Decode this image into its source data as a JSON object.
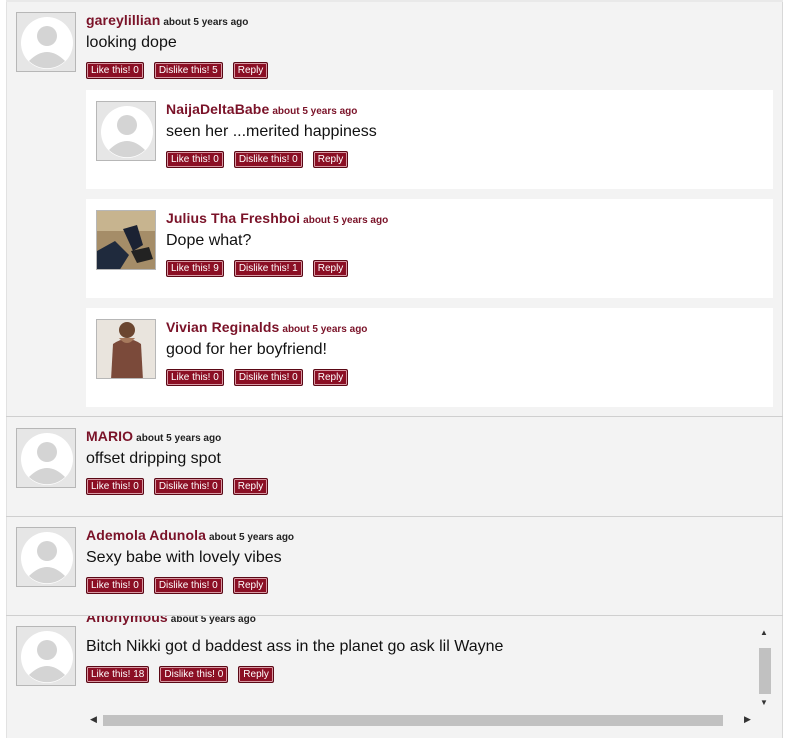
{
  "buttons": {
    "like": "Like this!",
    "dislike": "Dislike this!",
    "reply": "Reply"
  },
  "comments": [
    {
      "author": "gareylillian",
      "time": "about 5 years ago",
      "text": "looking dope",
      "likes": "0",
      "dislikes": "5"
    },
    {
      "author": "NaijaDeltaBabe",
      "time": "about 5 years ago",
      "text": "seen her ...merited happiness",
      "likes": "0",
      "dislikes": "0"
    },
    {
      "author": "Julius Tha Freshboi",
      "time": "about 5 years ago",
      "text": "Dope what?",
      "likes": "9",
      "dislikes": "1"
    },
    {
      "author": "Vivian Reginalds",
      "time": "about 5 years ago",
      "text": "good for her boyfriend!",
      "likes": "0",
      "dislikes": "0"
    },
    {
      "author": "MARIO",
      "time": "about 5 years ago",
      "text": "offset dripping spot",
      "likes": "0",
      "dislikes": "0"
    },
    {
      "author": "Ademola Adunola",
      "time": "about 5 years ago",
      "text": "Sexy babe with lovely vibes",
      "likes": "0",
      "dislikes": "0"
    },
    {
      "author": "Anonymous",
      "time": "about 5 years ago",
      "text": "Bitch Nikki got d baddest ass in the planet go ask lil Wayne",
      "likes": "18",
      "dislikes": "0"
    }
  ]
}
